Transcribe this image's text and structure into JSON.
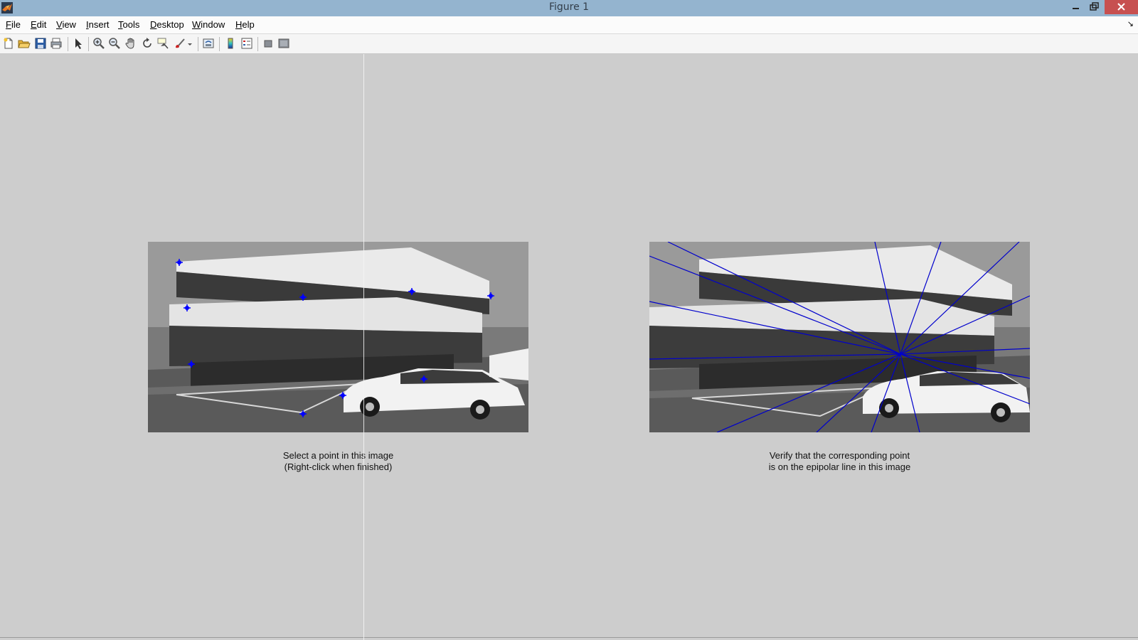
{
  "window": {
    "title": "Figure 1",
    "controls": [
      "minimize",
      "maximize",
      "close"
    ]
  },
  "menubar": {
    "items": [
      {
        "label": "File",
        "accel": "F",
        "rest": "ile"
      },
      {
        "label": "Edit",
        "accel": "E",
        "rest": "dit"
      },
      {
        "label": "View",
        "accel": "V",
        "rest": "iew"
      },
      {
        "label": "Insert",
        "accel": "I",
        "rest": "nsert"
      },
      {
        "label": "Tools",
        "accel": "T",
        "rest": "ools"
      },
      {
        "label": "Desktop",
        "accel": "D",
        "rest": "esktop"
      },
      {
        "label": "Window",
        "accel": "W",
        "rest": "indow"
      },
      {
        "label": "Help",
        "accel": "H",
        "rest": "elp"
      }
    ],
    "dock_glyph": "↘"
  },
  "toolbar": {
    "tools": [
      "new-figure-icon",
      "open-file-icon",
      "save-figure-icon",
      "print-figure-icon",
      "edit-plot-arrow-icon",
      "zoom-in-icon",
      "zoom-out-icon",
      "pan-hand-icon",
      "rotate-3d-icon",
      "data-cursor-icon",
      "brush-icon",
      "link-plot-icon",
      "insert-colorbar-icon",
      "insert-legend-icon",
      "hide-plot-tools-icon",
      "show-plot-tools-icon"
    ]
  },
  "figure": {
    "left_caption_line1": "Select a point in this image",
    "left_caption_line2": "(Right-click when finished)",
    "right_caption_line1": "Verify that the corresponding point",
    "right_caption_line2": "is on the epipolar line in this image",
    "marker_color": "#0000ff",
    "epipolar_line_color": "#0000cc",
    "image_description_icon": "building-and-car-grayscale-photo"
  },
  "colors": {
    "titlebar": "#94b4cf",
    "close_button": "#c75050",
    "figure_background": "#cdcdcd"
  }
}
